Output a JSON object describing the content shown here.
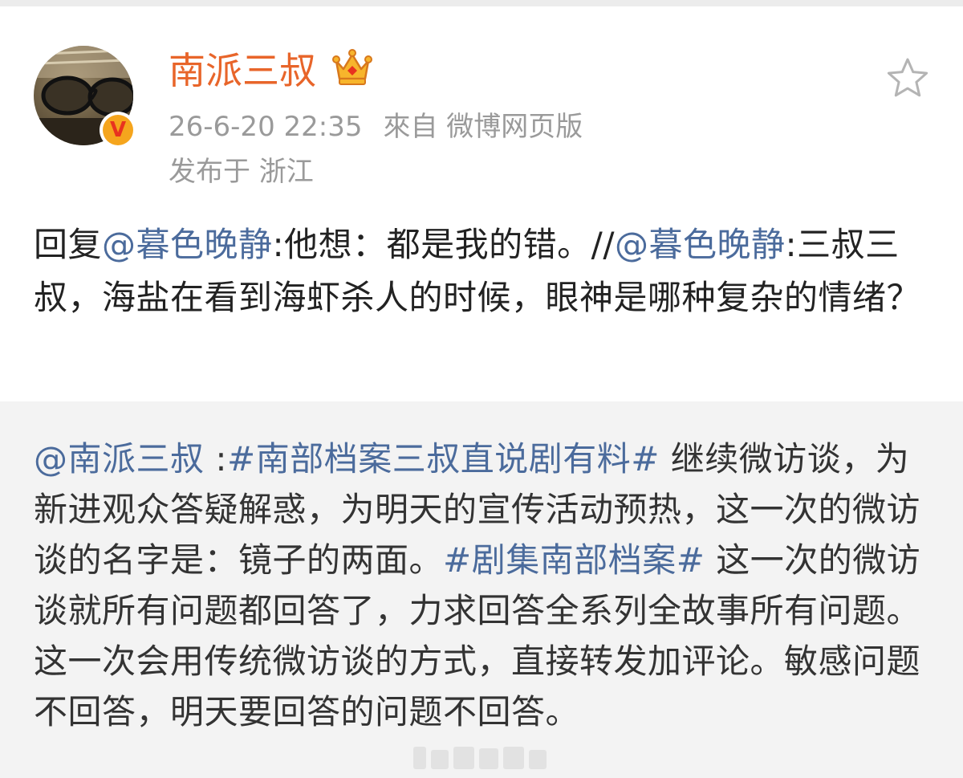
{
  "post": {
    "author": "南派三叔",
    "date": "26-6-20 22:35",
    "source": "來自 微博网页版",
    "location": "发布于 浙江",
    "text": {
      "reply_prefix": "回复",
      "reply_to": "@暮色晚静",
      "reply_body": ":他想：都是我的错。//",
      "quoted_user": "@暮色晚静",
      "quoted_body": ":三叔三叔，海盐在看到海虾杀人的时候，眼神是哪种复杂的情绪？"
    }
  },
  "repost": {
    "author_mention": "@南派三叔",
    "sep": " :",
    "topic1": "#南部档案三叔直说剧有料#",
    "body1": " 继续微访谈，为新进观众答疑解惑，为明天的宣传活动预热，这一次的微访谈的名字是：镜子的两面。",
    "topic2": "#剧集南部档案#",
    "body2": " 这一次的微访谈就所有问题都回答了，力求回答全系列全故事所有问题。这一次会用传统微访谈的方式，直接转发加评论。敏感问题不回答，明天要回答的问题不回答。"
  },
  "icons": {
    "avatar": "avatar-glasses-photo",
    "verified": "verified-v-badge",
    "vip": "crown-icon",
    "favorite": "star-icon"
  },
  "colors": {
    "username": "#e8652a",
    "link": "#4b6b9c",
    "meta": "#9a9a9a",
    "repost_bg": "#f3f3f3"
  }
}
